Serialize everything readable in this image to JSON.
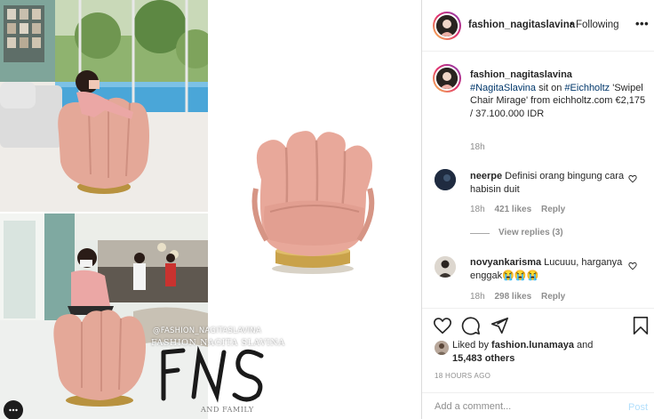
{
  "header": {
    "username": "fashion_nagitaslavina",
    "separator": "•",
    "follow_status": "Following",
    "more_label": "•••"
  },
  "caption": {
    "username": "fashion_nagitaslavina",
    "hashtag_person": "#NagitaSlavina",
    "text_sit_on": "sit on",
    "hashtag_brand": "#Eichholtz",
    "body": "'Swipel Chair Mirage' from eichholtz.com €2,175 / 37.100.000 IDR",
    "time": "18h"
  },
  "comments": [
    {
      "username": "neerpe",
      "text": "Definisi orang bingung cara habisin duit",
      "time": "18h",
      "likes": "421 likes",
      "reply_label": "Reply",
      "view_replies": "View replies (3)"
    },
    {
      "username": "novyankarisma",
      "text": "Lucuuu, harganya enggak😭😭😭",
      "time": "18h",
      "likes": "298 likes",
      "reply_label": "Reply"
    }
  ],
  "likes": {
    "prefix": "Liked by",
    "user": "fashion.lunamaya",
    "conjunction": "and",
    "others": "15,483 others"
  },
  "posted_time": "18 HOURS AGO",
  "composer": {
    "placeholder": "Add a comment...",
    "post_label": "Post"
  },
  "watermark": {
    "handle": "@FASHION_NAGITASLAVINA",
    "name": "FASHION NAGITA SLAVINA",
    "logo": "FNS",
    "tagline": "AND FAMILY"
  },
  "colors": {
    "accent_link": "#00376b",
    "chair_pink": "#e8a89a",
    "chair_gold": "#c9a24a",
    "secondary_text": "#8e8e8e",
    "post_disabled": "#b2dffc"
  },
  "icons": [
    "heart-icon",
    "comment-icon",
    "share-icon",
    "bookmark-icon",
    "more-horizontal-icon"
  ]
}
